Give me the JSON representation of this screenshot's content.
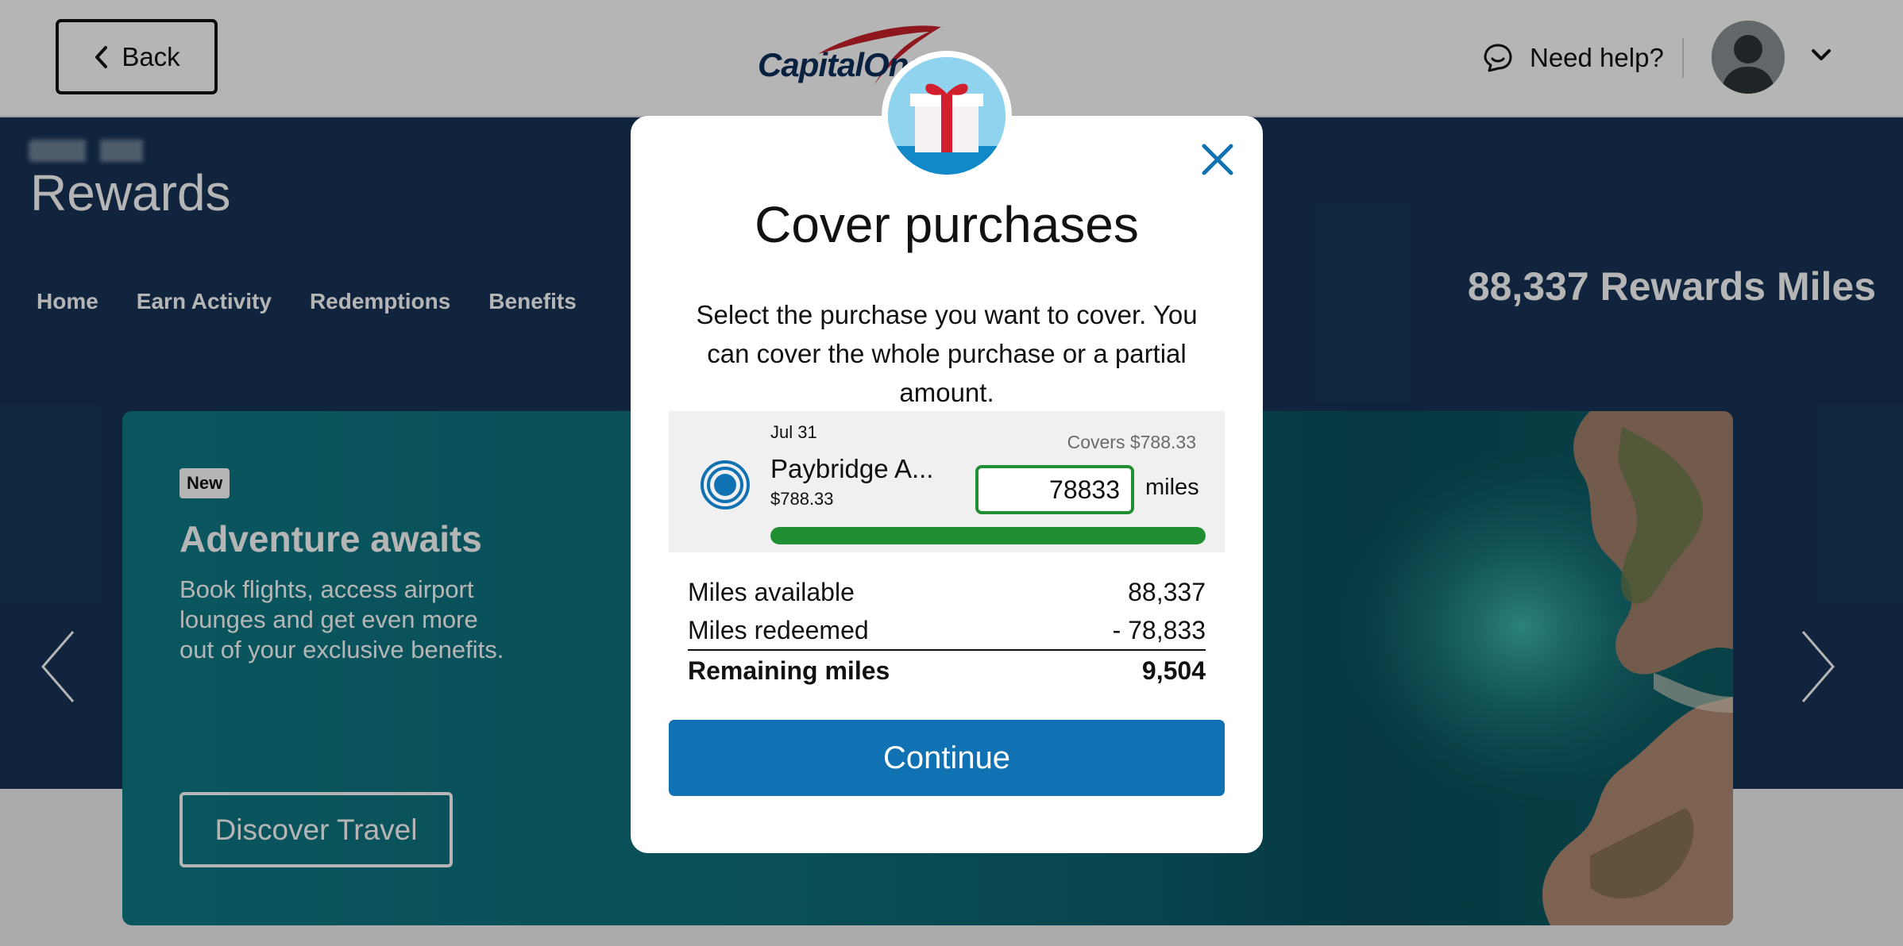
{
  "header": {
    "back_label": "Back",
    "brand_text": "CapitalOne",
    "help_label": "Need help?",
    "icons": {
      "back": "chevron-left-icon",
      "help": "chat-bubble-icon",
      "avatar": "user-avatar-icon",
      "menu": "chevron-down-icon"
    }
  },
  "page": {
    "title": "Rewards",
    "miles_total": "88,337 Rewards Miles",
    "nav": [
      "Home",
      "Earn Activity",
      "Redemptions",
      "Benefits"
    ]
  },
  "banner": {
    "badge": "New",
    "title": "Adventure awaits",
    "description": "Book flights, access airport lounges and get even more out of your exclusive benefits.",
    "cta": "Discover Travel"
  },
  "modal": {
    "title": "Cover purchases",
    "description": "Select the purchase you want to cover. You can cover the whole purchase or a partial amount.",
    "purchase": {
      "date": "Jul 31",
      "merchant": "Paybridge A...",
      "amount": "$788.33",
      "covers": "Covers $788.33",
      "miles_value": "78833",
      "miles_unit": "miles",
      "progress_percent": 100
    },
    "summary": {
      "available_label": "Miles available",
      "available_value": "88,337",
      "redeemed_label": "Miles redeemed",
      "redeemed_value": "- 78,833",
      "remaining_label": "Remaining miles",
      "remaining_value": "9,504"
    },
    "continue_label": "Continue",
    "icons": {
      "hero": "gift-icon",
      "close": "close-icon",
      "select": "radio-selected-icon"
    }
  },
  "colors": {
    "brand_navy": "#173457",
    "accent_blue": "#1172b3",
    "success_green": "#1f8f31",
    "banner_teal": "#0f7a86"
  }
}
